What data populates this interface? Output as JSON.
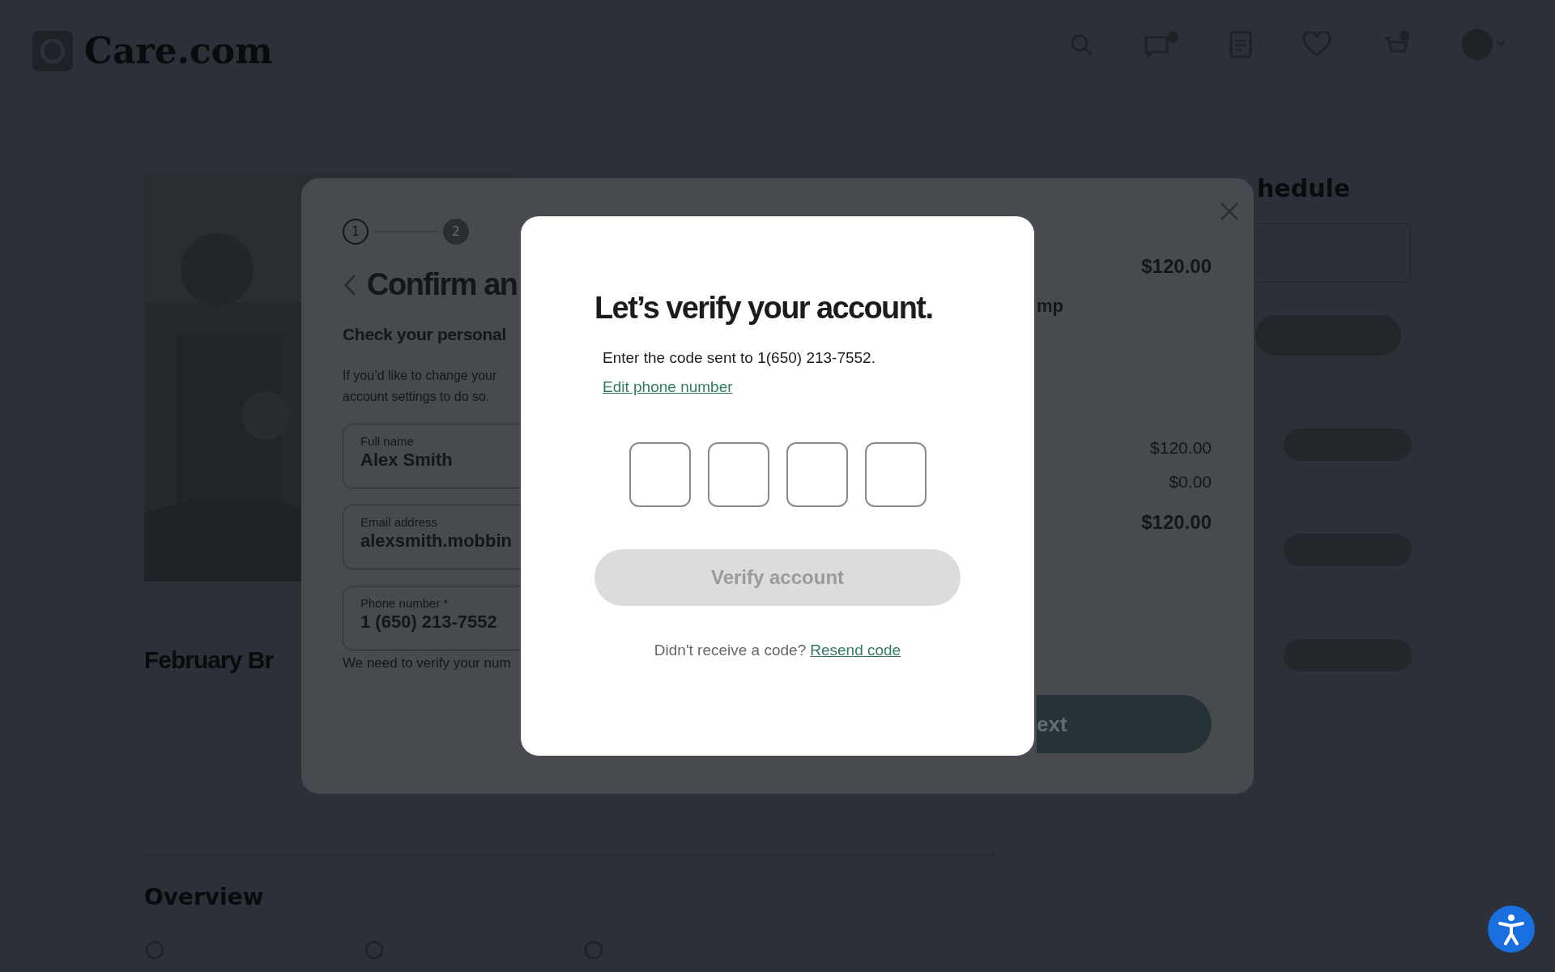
{
  "header": {
    "logo": "Care.com"
  },
  "listing": {
    "title": "February Br",
    "section_title": "Overview"
  },
  "schedule": {
    "title": "hedule"
  },
  "checkout_modal": {
    "steps": [
      {
        "label": "1",
        "active": true
      },
      {
        "label": "2",
        "active": false
      }
    ],
    "title": "Confirm an",
    "subtitle": "Check your personal",
    "note_lines": [
      "If you’d like to change your",
      "account settings to do so."
    ],
    "fields": [
      {
        "label": "Full name",
        "value": "Alex Smith"
      },
      {
        "label": "Email address",
        "value": "alexsmith.mobbin"
      },
      {
        "label": "Phone number *",
        "value": "1 (650) 213-7552"
      }
    ],
    "field_hint": "We need to verify your num",
    "top_price": "$120.00",
    "summary_label": "mp",
    "prices": [
      {
        "value": "$120.00",
        "kind": "line"
      },
      {
        "value": "$0.00",
        "kind": "line"
      },
      {
        "value": "$120.00",
        "kind": "total"
      }
    ],
    "next_button": "ext"
  },
  "verify_dialog": {
    "title": "Let’s verify your account.",
    "message": "Enter the code sent to 1(650) 213-7552.",
    "edit_link": "Edit phone number",
    "code_boxes": [
      {
        "filled": false
      },
      {
        "filled": false
      },
      {
        "filled": false
      },
      {
        "filled": false
      }
    ],
    "verify_button": {
      "label": "Verify account",
      "disabled": true
    },
    "resend_prompt": "Didn't receive a code?",
    "resend_link": "Resend code"
  }
}
